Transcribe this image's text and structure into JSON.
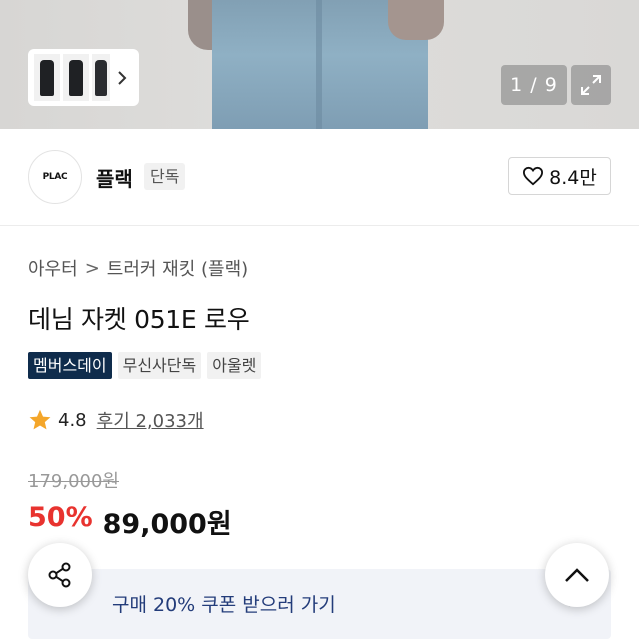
{
  "gallery": {
    "counter": "1 / 9",
    "thumbnails": [
      "thumbnail-1",
      "thumbnail-2",
      "thumbnail-3"
    ],
    "next_icon": "chevron-right-icon",
    "expand_icon": "expand-icon"
  },
  "brand": {
    "logo_text": "PLAC",
    "name": "플랙",
    "badge": "단독",
    "likes": "8.4만",
    "like_icon": "heart-icon"
  },
  "breadcrumb": {
    "items": [
      "아우터",
      "트러커 재킷 (플랙)"
    ],
    "separator": ">"
  },
  "product": {
    "title": "데님 자켓 051E 로우",
    "tags": [
      "멤버스데이",
      "무신사단독",
      "아울렛"
    ],
    "rating": "4.8",
    "reviews": "후기 2,033개",
    "original_price": "179,000원",
    "discount": "50%",
    "price": "89,000원"
  },
  "coupon": {
    "text": "구매 20% 쿠폰 받으러 가기"
  },
  "colors": {
    "discount": "#e8332f",
    "member_tag": "#0f2c4c",
    "coupon_text": "#233c7a",
    "star": "#f4a62a"
  }
}
